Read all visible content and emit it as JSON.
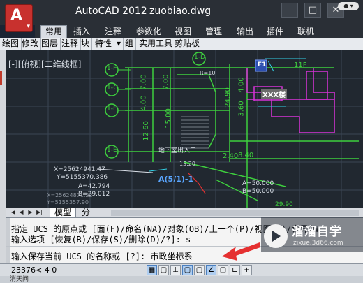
{
  "window": {
    "app_name": "AutoCAD 2012",
    "file_name": "zuobiao.dwg",
    "minimize_glyph": "—",
    "maximize_glyph": "□",
    "close_glyph": "✕",
    "app_glyph": "A",
    "app_caret": "▾"
  },
  "ribbon": {
    "tabs": [
      "常用",
      "插入",
      "注释",
      "参数化",
      "视图",
      "管理",
      "输出",
      "插件",
      "联机"
    ],
    "active_tab": "常用",
    "overflow_glyph": "● ▾",
    "panels": [
      "绘图",
      "修改",
      "图层",
      "注释",
      "块",
      "特性",
      "组",
      "实用工具",
      "剪贴板"
    ]
  },
  "viewport": {
    "label": "[-][俯视][二维线框]"
  },
  "drawing": {
    "grid_labels": [
      "1-H",
      "1-G",
      "1-F",
      "1-E",
      "1-D"
    ],
    "point_label": "A(5/1)-1",
    "coord_x1": "X=25624941.47",
    "coord_y1": "Y=5155370.386",
    "coord_a1": "A=42.794",
    "coord_b1": "B=29.012",
    "coord_x2": "X=25624871.22",
    "coord_y2": "Y=5155357.90",
    "coord_a2": "A=50.000",
    "coord_b2": "B=50.000",
    "entrance_label": "地下室出入口",
    "room_label": "XXX楼",
    "floor_label": "F1",
    "floor_tag": "11F",
    "dim_values": [
      "7.00",
      "4.00",
      "12.60",
      "7.00",
      "15.00",
      "4.00",
      "24.90",
      "3.60",
      "8.40",
      "2.40",
      "29.90",
      "R=10",
      "15.20"
    ]
  },
  "model_tabs": {
    "model": "模型",
    "layout": "分",
    "nav_first": "|◀",
    "nav_prev": "◀",
    "nav_next": "▶",
    "nav_last": "▶|"
  },
  "command": {
    "line1": "指定 UCS 的原点或 [面(F)/命名(NA)/对象(OB)/上一个(P)/视图(V)/世界(W",
    "line2": "输入选项 [恢复(R)/保存(S)/删除(D)/?]: s",
    "line3": "输入保存当前 UCS 的名称或 [?]: 市政坐标系"
  },
  "watermark": {
    "title": "溜溜自学",
    "url": "zixue.3d66.com"
  },
  "status": {
    "coords": "23376< 4   0",
    "buttons": [
      "▦",
      "▢",
      "⊥",
      "▢",
      "▢",
      "∠",
      "▢",
      "⊏",
      "+"
    ],
    "bottom_text": "消天问"
  },
  "colors": {
    "title_bg": "#2a2f36",
    "canvas_bg": "#212830",
    "cad_green": "#3ed03e",
    "cad_magenta": "#d832d8",
    "cad_cyan": "#34d0e6",
    "cad_red": "#e53030",
    "app_red": "#c8312e"
  }
}
